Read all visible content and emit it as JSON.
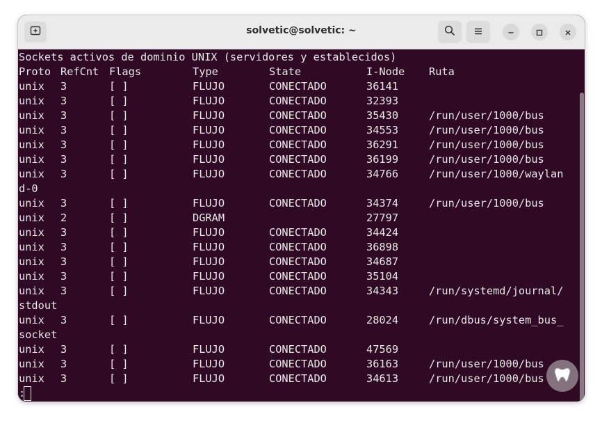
{
  "window": {
    "title": "solvetic@solvetic: ~"
  },
  "icons": {
    "new_tab": "new-tab-icon",
    "search": "search-icon",
    "menu": "hamburger-menu-icon",
    "minimize": "minimize-icon",
    "maximize": "maximize-icon",
    "close": "close-icon"
  },
  "terminal": {
    "heading": "Sockets activos de dominio UNIX (servidores y establecidos)",
    "headers": {
      "proto": "Proto",
      "refcnt": "RefCnt",
      "flags": "Flags",
      "type": "Type",
      "state": "State",
      "inode": "I-Node",
      "path": "Ruta"
    },
    "rows": [
      {
        "proto": "unix",
        "refcnt": "3",
        "flags": "[ ]",
        "type": "FLUJO",
        "state": "CONECTADO",
        "inode": "36141",
        "path": ""
      },
      {
        "proto": "unix",
        "refcnt": "3",
        "flags": "[ ]",
        "type": "FLUJO",
        "state": "CONECTADO",
        "inode": "32393",
        "path": ""
      },
      {
        "proto": "unix",
        "refcnt": "3",
        "flags": "[ ]",
        "type": "FLUJO",
        "state": "CONECTADO",
        "inode": "35430",
        "path": "/run/user/1000/bus"
      },
      {
        "proto": "unix",
        "refcnt": "3",
        "flags": "[ ]",
        "type": "FLUJO",
        "state": "CONECTADO",
        "inode": "34553",
        "path": "/run/user/1000/bus"
      },
      {
        "proto": "unix",
        "refcnt": "3",
        "flags": "[ ]",
        "type": "FLUJO",
        "state": "CONECTADO",
        "inode": "36291",
        "path": "/run/user/1000/bus"
      },
      {
        "proto": "unix",
        "refcnt": "3",
        "flags": "[ ]",
        "type": "FLUJO",
        "state": "CONECTADO",
        "inode": "36199",
        "path": "/run/user/1000/bus"
      },
      {
        "proto": "unix",
        "refcnt": "3",
        "flags": "[ ]",
        "type": "FLUJO",
        "state": "CONECTADO",
        "inode": "34766",
        "path": "/run/user/1000/waylan"
      },
      {
        "wrap": "d-0"
      },
      {
        "proto": "unix",
        "refcnt": "3",
        "flags": "[ ]",
        "type": "FLUJO",
        "state": "CONECTADO",
        "inode": "34374",
        "path": "/run/user/1000/bus"
      },
      {
        "proto": "unix",
        "refcnt": "2",
        "flags": "[ ]",
        "type": "DGRAM",
        "state": "",
        "inode": "27797",
        "path": ""
      },
      {
        "proto": "unix",
        "refcnt": "3",
        "flags": "[ ]",
        "type": "FLUJO",
        "state": "CONECTADO",
        "inode": "34424",
        "path": ""
      },
      {
        "proto": "unix",
        "refcnt": "3",
        "flags": "[ ]",
        "type": "FLUJO",
        "state": "CONECTADO",
        "inode": "36898",
        "path": ""
      },
      {
        "proto": "unix",
        "refcnt": "3",
        "flags": "[ ]",
        "type": "FLUJO",
        "state": "CONECTADO",
        "inode": "34687",
        "path": ""
      },
      {
        "proto": "unix",
        "refcnt": "3",
        "flags": "[ ]",
        "type": "FLUJO",
        "state": "CONECTADO",
        "inode": "35104",
        "path": ""
      },
      {
        "proto": "unix",
        "refcnt": "3",
        "flags": "[ ]",
        "type": "FLUJO",
        "state": "CONECTADO",
        "inode": "34343",
        "path": "/run/systemd/journal/"
      },
      {
        "wrap": "stdout"
      },
      {
        "proto": "unix",
        "refcnt": "3",
        "flags": "[ ]",
        "type": "FLUJO",
        "state": "CONECTADO",
        "inode": "28024",
        "path": "/run/dbus/system_bus_"
      },
      {
        "wrap": "socket"
      },
      {
        "proto": "unix",
        "refcnt": "3",
        "flags": "[ ]",
        "type": "FLUJO",
        "state": "CONECTADO",
        "inode": "47569",
        "path": ""
      },
      {
        "proto": "unix",
        "refcnt": "3",
        "flags": "[ ]",
        "type": "FLUJO",
        "state": "CONECTADO",
        "inode": "36163",
        "path": "/run/user/1000/bus"
      },
      {
        "proto": "unix",
        "refcnt": "3",
        "flags": "[ ]",
        "type": "FLUJO",
        "state": "CONECTADO",
        "inode": "34613",
        "path": "/run/user/1000/bus"
      }
    ],
    "prompt": ":"
  },
  "colors": {
    "terminal_bg": "#300a24",
    "terminal_fg": "#e8e8e8",
    "titlebar_bg": "#ebebeb"
  }
}
